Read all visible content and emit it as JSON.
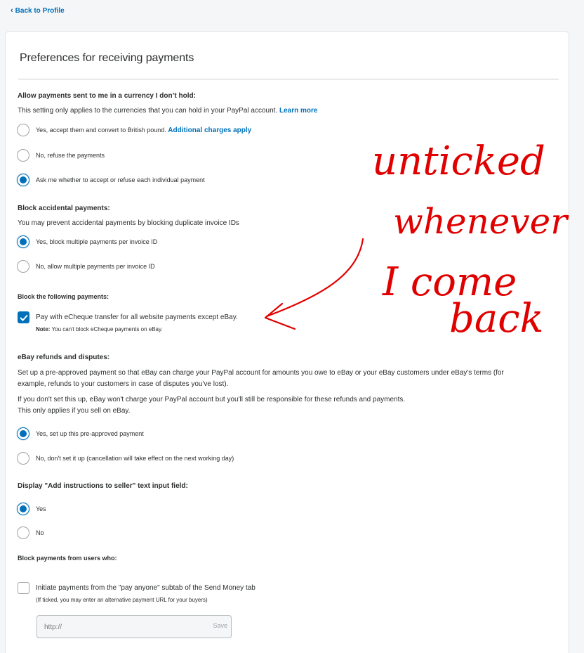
{
  "nav": {
    "back_label": "Back to Profile"
  },
  "page": {
    "title": "Preferences for receiving payments"
  },
  "currency": {
    "heading": "Allow payments sent to me in a currency I don’t hold:",
    "desc": "This setting only applies to the currencies that you can hold in your PayPal account.",
    "learn_more": "Learn more",
    "options": [
      {
        "label": "Yes, accept them and convert to British pound.",
        "link": "Additional charges apply",
        "selected": false
      },
      {
        "label": "No, refuse the payments",
        "selected": false
      },
      {
        "label": "Ask me whether to accept or refuse each individual payment",
        "selected": true
      }
    ]
  },
  "accidental": {
    "heading": "Block accidental payments:",
    "desc": "You may prevent accidental payments by blocking duplicate invoice IDs",
    "options": [
      {
        "label": "Yes, block multiple payments per invoice ID",
        "selected": true
      },
      {
        "label": "No, allow multiple payments per invoice ID",
        "selected": false
      }
    ]
  },
  "block": {
    "heading": "Block the following payments:",
    "checkbox_label": "Pay with eCheque transfer for all website payments except eBay.",
    "checked": true,
    "note_bold": "Note:",
    "note_text": "You can't block eCheque payments on eBay."
  },
  "ebay": {
    "heading": "eBay refunds and disputes:",
    "desc_line1": "Set up a pre-approved payment so that eBay can charge your PayPal account for amounts you owe to eBay or your eBay customers under eBay's terms (for",
    "desc_line2": "example, refunds to your customers in case of disputes you've lost).",
    "desc_line3": "If you don't set this up, eBay won't charge your PayPal account but you'll still be responsible for these refunds and payments.",
    "desc_line4": "This only applies if you sell on eBay.",
    "options": [
      {
        "label": "Yes, set up this pre-approved payment",
        "selected": true
      },
      {
        "label": "No, don't set it up (cancellation will take effect on the next working day)",
        "selected": false
      }
    ]
  },
  "instructions": {
    "heading": "Display \"Add instructions to seller\" text input field:",
    "options": [
      {
        "label": "Yes",
        "selected": true
      },
      {
        "label": "No",
        "selected": false
      }
    ]
  },
  "users": {
    "heading": "Block payments from users who:",
    "checkbox_label": "Initiate payments from the \"pay anyone\" subtab of the Send Money tab",
    "checked": false,
    "sub_note": "(If ticked, you may enter an alternative payment URL for your buyers)",
    "url_placeholder": "http://",
    "save_label": "Save"
  },
  "annotation": {
    "lines": [
      "unticked",
      "whenever",
      "I come",
      "back"
    ],
    "color": "#e00000"
  },
  "colors": {
    "accent": "#0070ba",
    "text": "#2c2e2f",
    "border": "#9da3a6"
  }
}
